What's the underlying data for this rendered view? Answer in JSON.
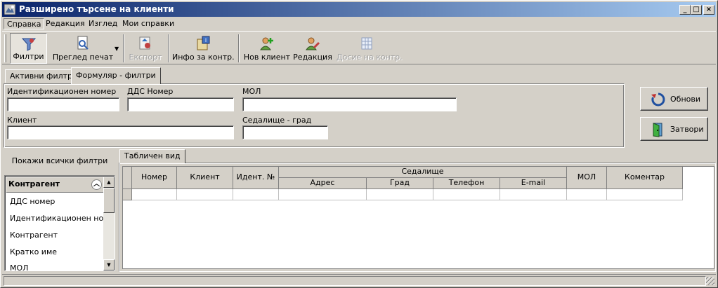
{
  "window": {
    "title": "Разширено търсене на клиенти"
  },
  "menu": [
    "Справка",
    "Редакция",
    "Изглед",
    "Мои справки"
  ],
  "toolbar": {
    "filters": "Филтри",
    "print_preview": "Преглед печат",
    "export": "Експорт",
    "contract_info": "Инфо за контр.",
    "new_client": "Нов клиент",
    "edit": "Редакция",
    "contract_dossier": "Досие на контр."
  },
  "tabs": {
    "active_filters": "Активни филтри",
    "form_filters": "Формуляр - филтри"
  },
  "form": {
    "id_number_label": "Идентификационен номер",
    "id_number_value": "",
    "vat_label": "ДДС Номер",
    "vat_value": "",
    "mol_label": "МОЛ",
    "mol_value": "",
    "client_label": "Клиент",
    "client_value": "",
    "hq_city_label": "Седалище - град",
    "hq_city_value": ""
  },
  "actions": {
    "refresh": "Обнови",
    "close": "Затвори"
  },
  "left_panel": {
    "show_all": "Покажи всички филтри",
    "group": "Контрагент",
    "items": [
      "ДДС номер",
      "Идентификационен номер",
      "Контрагент",
      "Кратко име",
      "МОЛ"
    ]
  },
  "grid": {
    "tab": "Табличен вид",
    "cols": {
      "number": "Номер",
      "client": "Клиент",
      "ident": "Идент. №",
      "hq": "Седалище",
      "address": "Адрес",
      "city": "Град",
      "phone": "Телефон",
      "email": "E-mail",
      "mol": "МОЛ",
      "comment": "Коментар"
    }
  }
}
